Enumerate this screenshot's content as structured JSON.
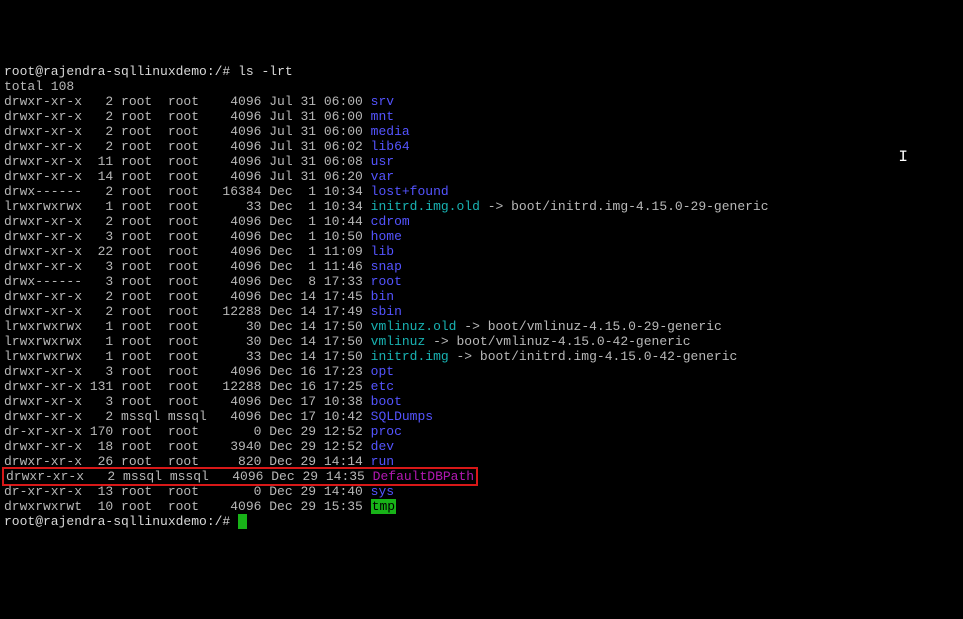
{
  "prompt1": "root@rajendra-sqllinuxdemo:/#",
  "command": "ls -lrt",
  "total": "total 108",
  "rows": [
    {
      "perm": "drwxr-xr-x",
      "lnk": "  2",
      "own": "root ",
      "grp": "root ",
      "size": "  4096",
      "date": "Jul 31 06:00",
      "name": "srv",
      "cls": "blue"
    },
    {
      "perm": "drwxr-xr-x",
      "lnk": "  2",
      "own": "root ",
      "grp": "root ",
      "size": "  4096",
      "date": "Jul 31 06:00",
      "name": "mnt",
      "cls": "blue"
    },
    {
      "perm": "drwxr-xr-x",
      "lnk": "  2",
      "own": "root ",
      "grp": "root ",
      "size": "  4096",
      "date": "Jul 31 06:00",
      "name": "media",
      "cls": "blue"
    },
    {
      "perm": "drwxr-xr-x",
      "lnk": "  2",
      "own": "root ",
      "grp": "root ",
      "size": "  4096",
      "date": "Jul 31 06:02",
      "name": "lib64",
      "cls": "blue"
    },
    {
      "perm": "drwxr-xr-x",
      "lnk": " 11",
      "own": "root ",
      "grp": "root ",
      "size": "  4096",
      "date": "Jul 31 06:08",
      "name": "usr",
      "cls": "blue"
    },
    {
      "perm": "drwxr-xr-x",
      "lnk": " 14",
      "own": "root ",
      "grp": "root ",
      "size": "  4096",
      "date": "Jul 31 06:20",
      "name": "var",
      "cls": "blue"
    },
    {
      "perm": "drwx------",
      "lnk": "  2",
      "own": "root ",
      "grp": "root ",
      "size": " 16384",
      "date": "Dec  1 10:34",
      "name": "lost+found",
      "cls": "blue"
    },
    {
      "perm": "lrwxrwxrwx",
      "lnk": "  1",
      "own": "root ",
      "grp": "root ",
      "size": "    33",
      "date": "Dec  1 10:34",
      "name": "initrd.img.old",
      "cls": "cyan",
      "arrow": " -> boot/initrd.img-4.15.0-29-generic"
    },
    {
      "perm": "drwxr-xr-x",
      "lnk": "  2",
      "own": "root ",
      "grp": "root ",
      "size": "  4096",
      "date": "Dec  1 10:44",
      "name": "cdrom",
      "cls": "blue"
    },
    {
      "perm": "drwxr-xr-x",
      "lnk": "  3",
      "own": "root ",
      "grp": "root ",
      "size": "  4096",
      "date": "Dec  1 10:50",
      "name": "home",
      "cls": "blue"
    },
    {
      "perm": "drwxr-xr-x",
      "lnk": " 22",
      "own": "root ",
      "grp": "root ",
      "size": "  4096",
      "date": "Dec  1 11:09",
      "name": "lib",
      "cls": "blue"
    },
    {
      "perm": "drwxr-xr-x",
      "lnk": "  3",
      "own": "root ",
      "grp": "root ",
      "size": "  4096",
      "date": "Dec  1 11:46",
      "name": "snap",
      "cls": "blue"
    },
    {
      "perm": "drwx------",
      "lnk": "  3",
      "own": "root ",
      "grp": "root ",
      "size": "  4096",
      "date": "Dec  8 17:33",
      "name": "root",
      "cls": "blue"
    },
    {
      "perm": "drwxr-xr-x",
      "lnk": "  2",
      "own": "root ",
      "grp": "root ",
      "size": "  4096",
      "date": "Dec 14 17:45",
      "name": "bin",
      "cls": "blue"
    },
    {
      "perm": "drwxr-xr-x",
      "lnk": "  2",
      "own": "root ",
      "grp": "root ",
      "size": " 12288",
      "date": "Dec 14 17:49",
      "name": "sbin",
      "cls": "blue"
    },
    {
      "perm": "lrwxrwxrwx",
      "lnk": "  1",
      "own": "root ",
      "grp": "root ",
      "size": "    30",
      "date": "Dec 14 17:50",
      "name": "vmlinuz.old",
      "cls": "cyan",
      "arrow": " -> boot/vmlinuz-4.15.0-29-generic"
    },
    {
      "perm": "lrwxrwxrwx",
      "lnk": "  1",
      "own": "root ",
      "grp": "root ",
      "size": "    30",
      "date": "Dec 14 17:50",
      "name": "vmlinuz",
      "cls": "cyan",
      "arrow": " -> boot/vmlinuz-4.15.0-42-generic"
    },
    {
      "perm": "lrwxrwxrwx",
      "lnk": "  1",
      "own": "root ",
      "grp": "root ",
      "size": "    33",
      "date": "Dec 14 17:50",
      "name": "initrd.img",
      "cls": "cyan",
      "arrow": " -> boot/initrd.img-4.15.0-42-generic"
    },
    {
      "perm": "drwxr-xr-x",
      "lnk": "  3",
      "own": "root ",
      "grp": "root ",
      "size": "  4096",
      "date": "Dec 16 17:23",
      "name": "opt",
      "cls": "blue"
    },
    {
      "perm": "drwxr-xr-x",
      "lnk": "131",
      "own": "root ",
      "grp": "root ",
      "size": " 12288",
      "date": "Dec 16 17:25",
      "name": "etc",
      "cls": "blue"
    },
    {
      "perm": "drwxr-xr-x",
      "lnk": "  3",
      "own": "root ",
      "grp": "root ",
      "size": "  4096",
      "date": "Dec 17 10:38",
      "name": "boot",
      "cls": "blue"
    },
    {
      "perm": "drwxr-xr-x",
      "lnk": "  2",
      "own": "mssql",
      "grp": "mssql",
      "size": "  4096",
      "date": "Dec 17 10:42",
      "name": "SQLDumps",
      "cls": "blue"
    },
    {
      "perm": "dr-xr-xr-x",
      "lnk": "170",
      "own": "root ",
      "grp": "root ",
      "size": "     0",
      "date": "Dec 29 12:52",
      "name": "proc",
      "cls": "blue"
    },
    {
      "perm": "drwxr-xr-x",
      "lnk": " 18",
      "own": "root ",
      "grp": "root ",
      "size": "  3940",
      "date": "Dec 29 12:52",
      "name": "dev",
      "cls": "blue"
    },
    {
      "perm": "drwxr-xr-x",
      "lnk": " 26",
      "own": "root ",
      "grp": "root ",
      "size": "   820",
      "date": "Dec 29 14:14",
      "name": "run",
      "cls": "blue"
    },
    {
      "perm": "drwxr-xr-x",
      "lnk": "  2",
      "own": "mssql",
      "grp": "mssql",
      "size": "  4096",
      "date": "Dec 29 14:35",
      "name": "DefaultDBPath",
      "cls": "magenta",
      "hl": true
    },
    {
      "perm": "dr-xr-xr-x",
      "lnk": " 13",
      "own": "root ",
      "grp": "root ",
      "size": "     0",
      "date": "Dec 29 14:40",
      "name": "sys",
      "cls": "blue"
    },
    {
      "perm": "drwxrwxrwt",
      "lnk": " 10",
      "own": "root ",
      "grp": "root ",
      "size": "  4096",
      "date": "Dec 29 15:35",
      "name": "tmp",
      "cls": "green-bg"
    }
  ],
  "prompt2": "root@rajendra-sqllinuxdemo:/#"
}
